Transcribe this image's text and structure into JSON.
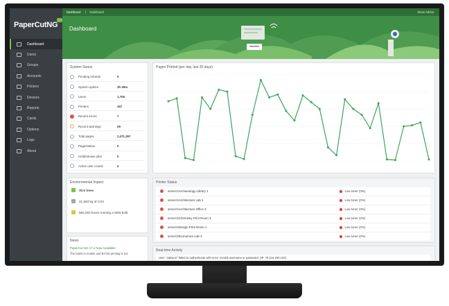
{
  "app": {
    "logo": "PaperCutNG"
  },
  "topbar": {
    "crumbs": [
      "Dashboard",
      "Dashboard"
    ],
    "user": "Steve Admin"
  },
  "header": {
    "title": "Dashboard"
  },
  "sidebar": {
    "items": [
      {
        "label": "Dashboard",
        "icon": "chart-icon"
      },
      {
        "label": "Users",
        "icon": "user-icon"
      },
      {
        "label": "Groups",
        "icon": "group-icon"
      },
      {
        "label": "Accounts",
        "icon": "accounts-icon"
      },
      {
        "label": "Printers",
        "icon": "printer-icon"
      },
      {
        "label": "Devices",
        "icon": "device-icon"
      },
      {
        "label": "Reports",
        "icon": "report-icon"
      },
      {
        "label": "Cards",
        "icon": "card-icon"
      },
      {
        "label": "Options",
        "icon": "gear-icon"
      },
      {
        "label": "Logs",
        "icon": "logs-icon"
      },
      {
        "label": "About",
        "icon": "info-icon"
      }
    ]
  },
  "system_status": {
    "title": "System Status",
    "rows": [
      {
        "label": "Pending refunds",
        "value": "0"
      },
      {
        "label": "System uptime",
        "value": "3h 26m"
      },
      {
        "label": "Users",
        "value": "1,705"
      },
      {
        "label": "Printers",
        "value": "167"
      },
      {
        "label": "Recent errors",
        "value": "7"
      },
      {
        "label": "Recent warnings",
        "value": "29"
      },
      {
        "label": "Total pages",
        "value": "2,471,357"
      },
      {
        "label": "Page/station",
        "value": "0"
      },
      {
        "label": "Hold/release jobs",
        "value": "0"
      },
      {
        "label": "Active user counts",
        "value": "0"
      }
    ]
  },
  "chart_data": {
    "type": "line",
    "title": "Pages Printed (per day, last 30 days)",
    "values": [
      3100,
      3250,
      150,
      50,
      3300,
      2700,
      3700,
      3600,
      250,
      100,
      2400,
      4200,
      3300,
      3450,
      2600,
      2100,
      3400,
      3050,
      2700,
      700,
      300,
      3200,
      2700,
      2400,
      1700,
      3000,
      80,
      50,
      1800,
      1850,
      2000,
      80
    ],
    "color": "#3aa55a"
  },
  "environment": {
    "title": "Environmental Impact",
    "rows": [
      {
        "text": "30.5 trees"
      },
      {
        "text": "31,593 kg of CO2"
      },
      {
        "text": "694,003 hours running a 60W bulb"
      }
    ]
  },
  "news": {
    "title": "News",
    "headline": "PaperCut NG 17.4 Now Available!",
    "body": "The latest in mobile and BYOD printing is out"
  },
  "printer_status": {
    "title": "Printer Status",
    "rows": [
      {
        "name": "server1\\Archaeology Library 1",
        "status": "Low toner (0%)"
      },
      {
        "name": "server1\\Architecture Lab 1",
        "status": "Low toner (0%)"
      },
      {
        "name": "server1\\Architecture Office 3",
        "status": "Low toner (0%)"
      },
      {
        "name": "server1\\Chemistry Print Room 3",
        "status": "Low toner (0%)"
      },
      {
        "name": "server1\\Design Print Room 1",
        "status": "Low toner (0%)"
      },
      {
        "name": "server1\\Economics Lab 3",
        "status": "Low toner (0%)"
      }
    ]
  },
  "realtime": {
    "title": "Real-time Activity",
    "row": "User \"JaDunn\" failed to authenticate with error: invalid username or password. (IP: 76.118.230.132)"
  }
}
